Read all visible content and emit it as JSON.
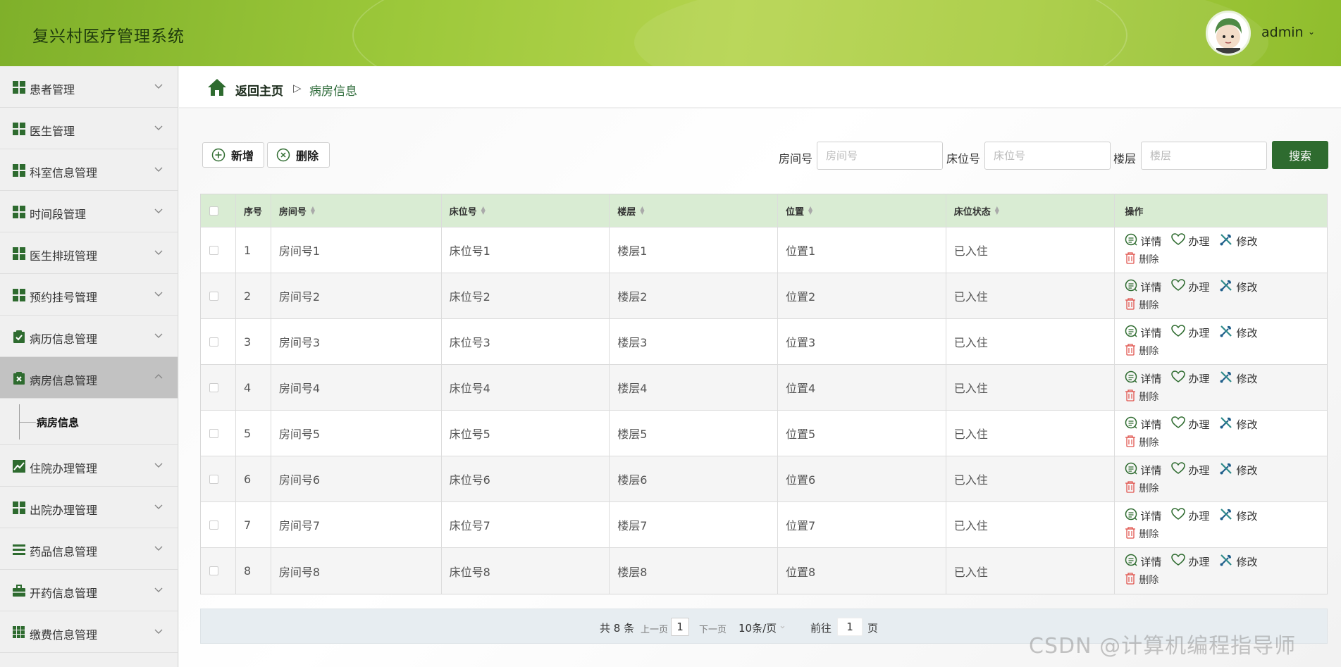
{
  "app": {
    "title": "复兴村医疗管理系统"
  },
  "user": {
    "name": "admin",
    "caret": "⌄"
  },
  "sidebar": {
    "items": [
      {
        "label": "患者管理",
        "icon": "grid-icon"
      },
      {
        "label": "医生管理",
        "icon": "grid-icon"
      },
      {
        "label": "科室信息管理",
        "icon": "grid-icon"
      },
      {
        "label": "时间段管理",
        "icon": "grid-icon"
      },
      {
        "label": "医生排班管理",
        "icon": "grid-icon"
      },
      {
        "label": "预约挂号管理",
        "icon": "grid-icon"
      },
      {
        "label": "病历信息管理",
        "icon": "clipboard-check-icon"
      },
      {
        "label": "病房信息管理",
        "icon": "clipboard-x-icon",
        "expanded": true
      },
      {
        "label": "住院办理管理",
        "icon": "chart-icon"
      },
      {
        "label": "出院办理管理",
        "icon": "grid-icon"
      },
      {
        "label": "药品信息管理",
        "icon": "list-icon"
      },
      {
        "label": "开药信息管理",
        "icon": "briefcase-icon"
      },
      {
        "label": "缴费信息管理",
        "icon": "grid-dense-icon"
      }
    ],
    "submenu": {
      "label": "病房信息"
    }
  },
  "breadcrumb": {
    "home": "返回主页",
    "separator": "▷",
    "current": "病房信息"
  },
  "toolbar": {
    "add_label": "新增",
    "delete_label": "删除"
  },
  "search": {
    "room_label": "房间号",
    "room_placeholder": "房间号",
    "bed_label": "床位号",
    "bed_placeholder": "床位号",
    "floor_label": "楼层",
    "floor_placeholder": "楼层",
    "button_label": "搜索"
  },
  "table": {
    "headers": {
      "index": "序号",
      "room": "房间号",
      "bed": "床位号",
      "floor": "楼层",
      "position": "位置",
      "status": "床位状态",
      "ops": "操作"
    },
    "ops": {
      "detail": "详情",
      "handle": "办理",
      "edit": "修改",
      "delete": "删除"
    },
    "rows": [
      {
        "index": "1",
        "room": "房间号1",
        "bed": "床位号1",
        "floor": "楼层1",
        "position": "位置1",
        "status": "已入住"
      },
      {
        "index": "2",
        "room": "房间号2",
        "bed": "床位号2",
        "floor": "楼层2",
        "position": "位置2",
        "status": "已入住"
      },
      {
        "index": "3",
        "room": "房间号3",
        "bed": "床位号3",
        "floor": "楼层3",
        "position": "位置3",
        "status": "已入住"
      },
      {
        "index": "4",
        "room": "房间号4",
        "bed": "床位号4",
        "floor": "楼层4",
        "position": "位置4",
        "status": "已入住"
      },
      {
        "index": "5",
        "room": "房间号5",
        "bed": "床位号5",
        "floor": "楼层5",
        "position": "位置5",
        "status": "已入住"
      },
      {
        "index": "6",
        "room": "房间号6",
        "bed": "床位号6",
        "floor": "楼层6",
        "position": "位置6",
        "status": "已入住"
      },
      {
        "index": "7",
        "room": "房间号7",
        "bed": "床位号7",
        "floor": "楼层7",
        "position": "位置7",
        "status": "已入住"
      },
      {
        "index": "8",
        "room": "房间号8",
        "bed": "床位号8",
        "floor": "楼层8",
        "position": "位置8",
        "status": "已入住"
      }
    ]
  },
  "pagination": {
    "total": "共 8 条",
    "prev": "上一页",
    "page": "1",
    "next": "下一页",
    "page_size": "10条/页",
    "goto_prefix": "前往",
    "goto_value": "1",
    "goto_suffix": "页"
  },
  "watermark": "CSDN @计算机编程指导师",
  "colors": {
    "primary": "#2e6b2f",
    "header_green": "#9cc83a",
    "table_head": "#d9ecd3",
    "danger": "#e0534d"
  }
}
